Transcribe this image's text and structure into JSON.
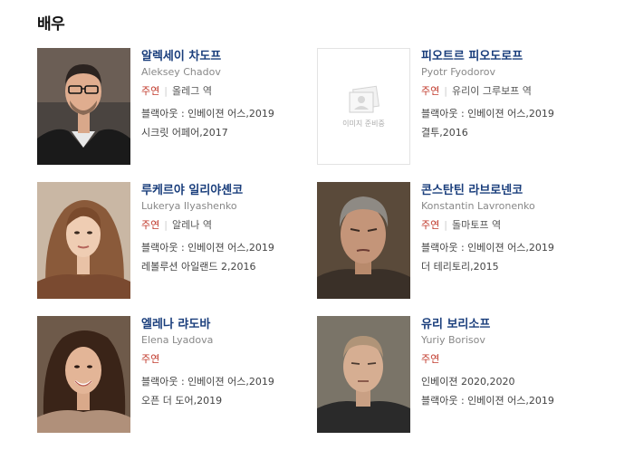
{
  "section": {
    "title": "배우"
  },
  "placeholder_text": "이미지 준비중",
  "actors": [
    {
      "name": "알렉세이 차도프",
      "eng": "Aleksey Chadov",
      "role": "주연",
      "character": "올레그 역",
      "films": [
        "블랙아웃 : 인베이젼 어스,2019",
        "시크릿 어페어,2017"
      ]
    },
    {
      "name": "피오트르 피오도로프",
      "eng": "Pyotr Fyodorov",
      "role": "주연",
      "character": "유리이 그루보프 역",
      "films": [
        "블랙아웃 : 인베이젼 어스,2019",
        "결투,2016"
      ]
    },
    {
      "name": "루케르야 일리야셴코",
      "eng": "Lukerya Ilyashenko",
      "role": "주연",
      "character": "알레나 역",
      "films": [
        "블랙아웃 : 인베이젼 어스,2019",
        "레볼루션 아일랜드 2,2016"
      ]
    },
    {
      "name": "콘스탄틴 라브로넨코",
      "eng": "Konstantin Lavronenko",
      "role": "주연",
      "character": "돌마토프 역",
      "films": [
        "블랙아웃 : 인베이젼 어스,2019",
        "더 테리토리,2015"
      ]
    },
    {
      "name": "엘레나 랴도바",
      "eng": "Elena Lyadova",
      "role": "주연",
      "character": "",
      "films": [
        "블랙아웃 : 인베이젼 어스,2019",
        "오픈 더 도어,2019"
      ]
    },
    {
      "name": "유리 보리소프",
      "eng": "Yuriy Borisov",
      "role": "주연",
      "character": "",
      "films": [
        "인베이젼 2020,2020",
        "블랙아웃 : 인베이젼 어스,2019"
      ]
    }
  ]
}
